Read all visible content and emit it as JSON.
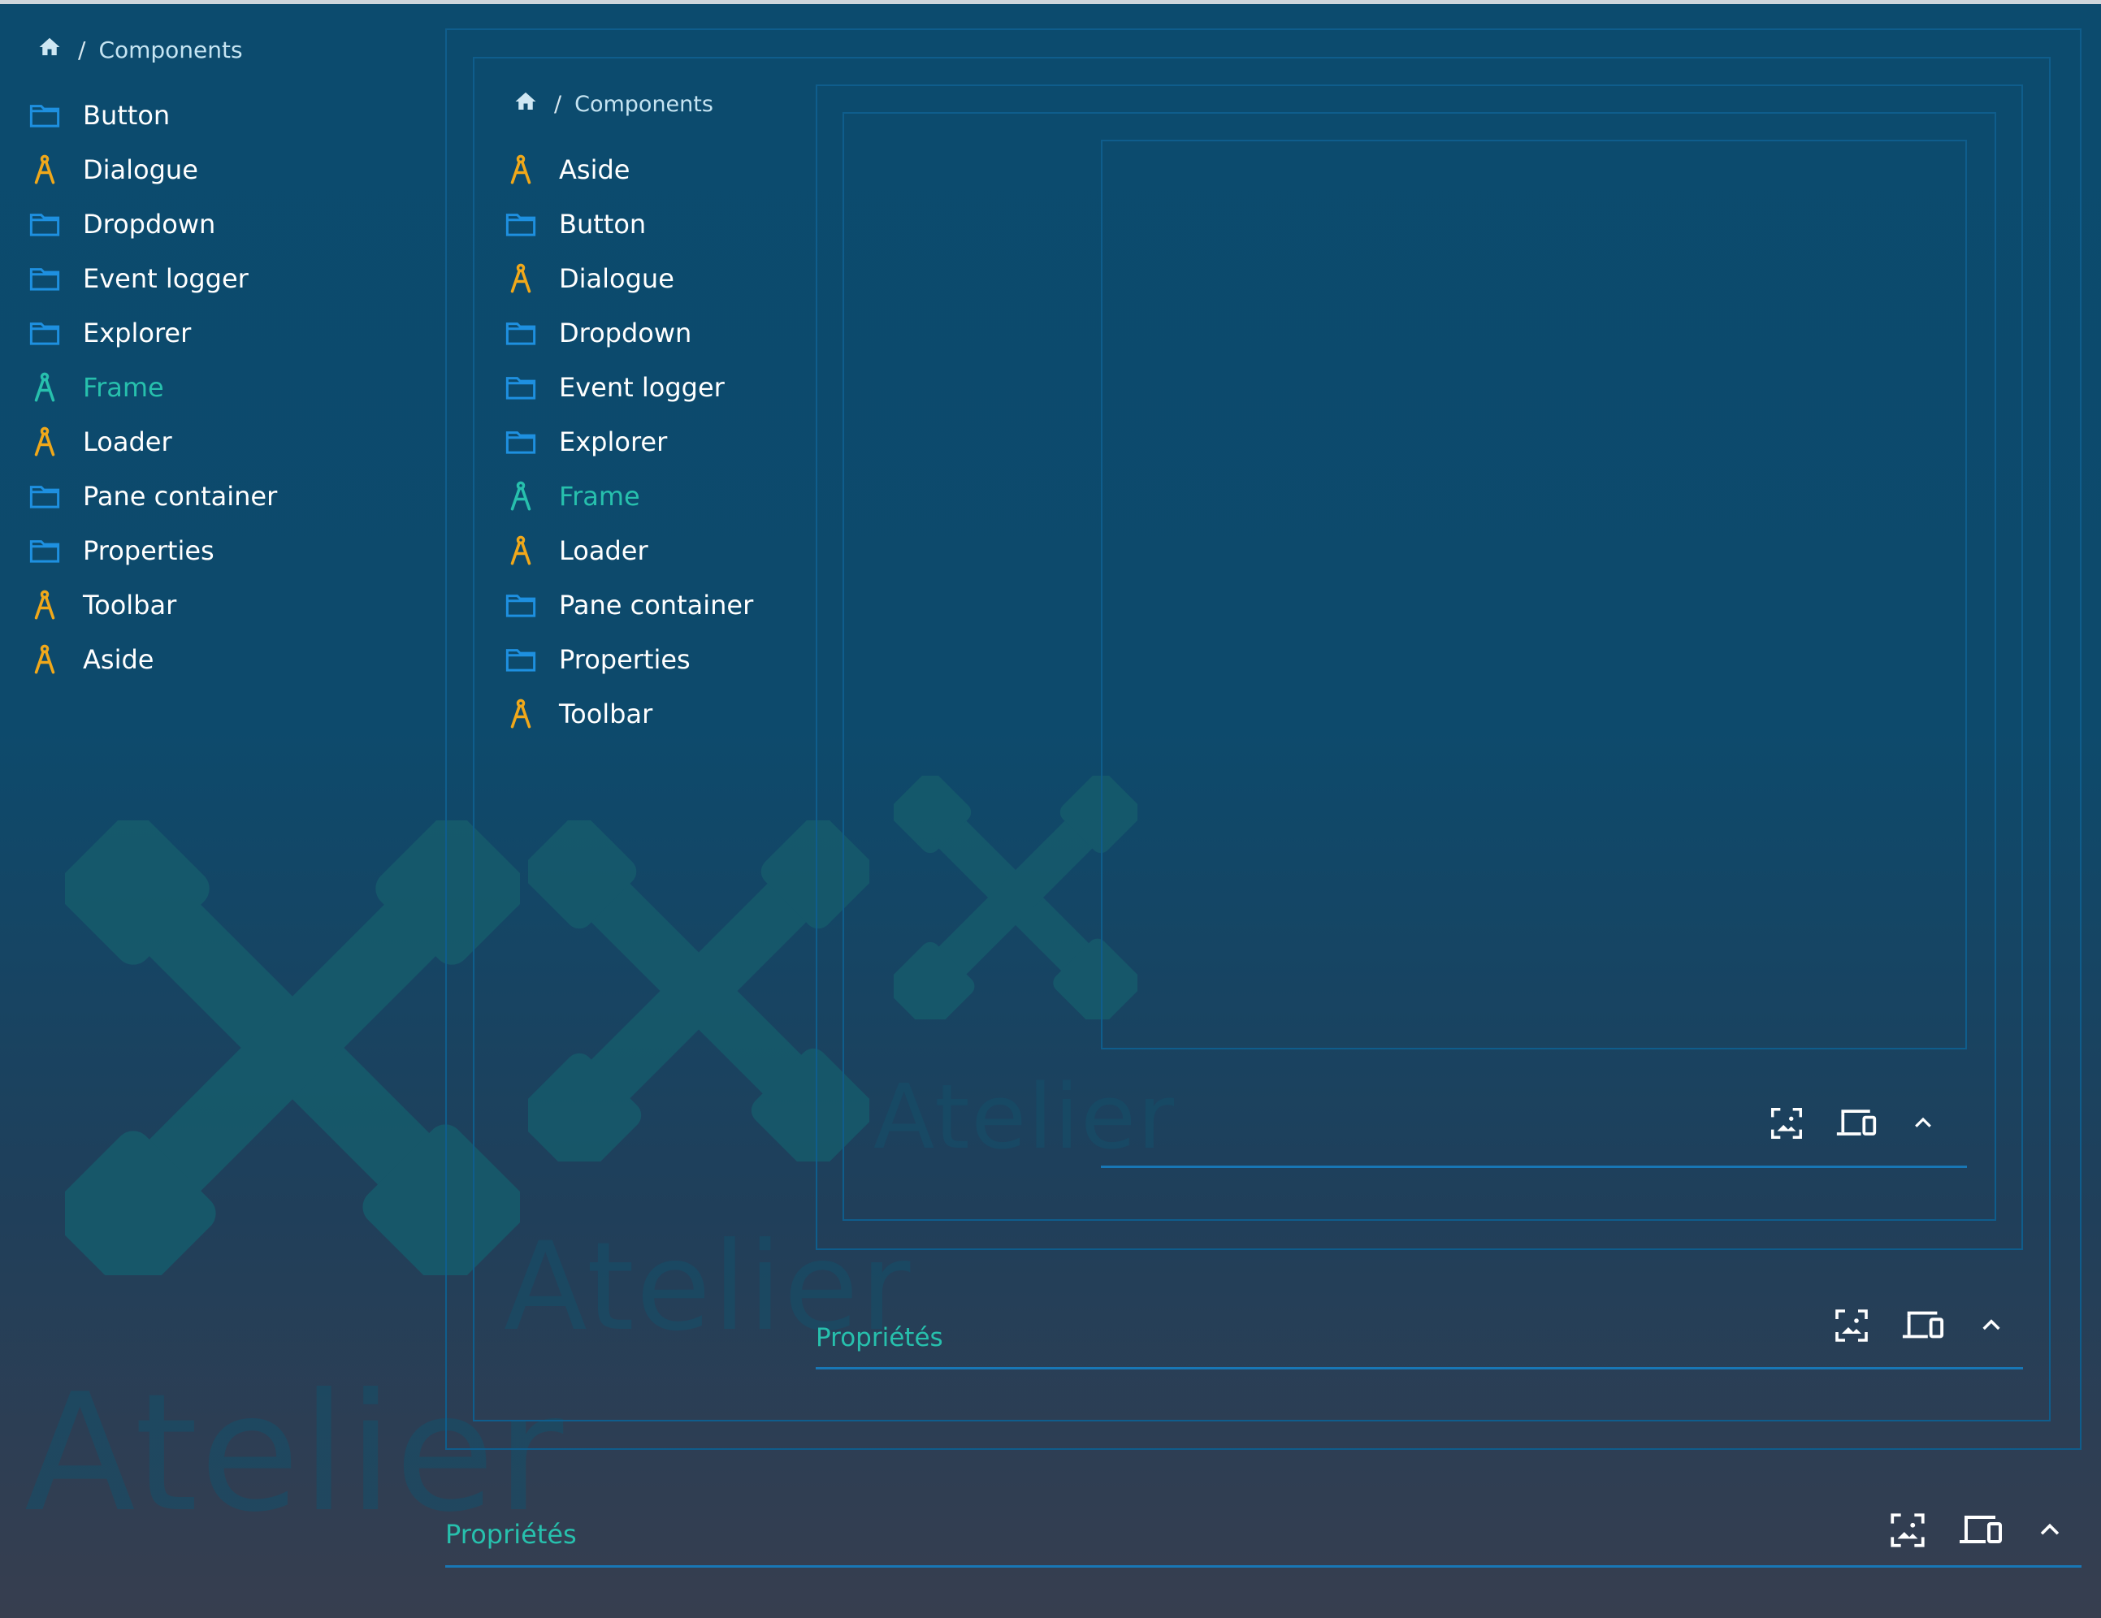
{
  "colors": {
    "accent": "#27c0ad",
    "folder": "#1e90e0",
    "compass": "#f0a81a",
    "border": "#0f5d8c",
    "underline": "#1877b5"
  },
  "watermark": {
    "text": "Atelier"
  },
  "breadcrumb": {
    "home_icon": "home-icon",
    "separator": "/",
    "label": "Components"
  },
  "level1": {
    "nav": [
      {
        "label": "Button",
        "icon": "folder-icon"
      },
      {
        "label": "Dialogue",
        "icon": "compass-icon"
      },
      {
        "label": "Dropdown",
        "icon": "folder-icon"
      },
      {
        "label": "Event logger",
        "icon": "folder-icon"
      },
      {
        "label": "Explorer",
        "icon": "folder-icon"
      },
      {
        "label": "Frame",
        "icon": "compass-icon",
        "active": true
      },
      {
        "label": "Loader",
        "icon": "compass-icon"
      },
      {
        "label": "Pane container",
        "icon": "folder-icon"
      },
      {
        "label": "Properties",
        "icon": "folder-icon"
      },
      {
        "label": "Toolbar",
        "icon": "compass-icon"
      },
      {
        "label": "Aside",
        "icon": "compass-icon"
      }
    ],
    "properties_label": "Propriétés"
  },
  "level2": {
    "nav": [
      {
        "label": "Aside",
        "icon": "compass-icon"
      },
      {
        "label": "Button",
        "icon": "folder-icon"
      },
      {
        "label": "Dialogue",
        "icon": "compass-icon"
      },
      {
        "label": "Dropdown",
        "icon": "folder-icon"
      },
      {
        "label": "Event logger",
        "icon": "folder-icon"
      },
      {
        "label": "Explorer",
        "icon": "folder-icon"
      },
      {
        "label": "Frame",
        "icon": "compass-icon",
        "active": true
      },
      {
        "label": "Loader",
        "icon": "compass-icon"
      },
      {
        "label": "Pane container",
        "icon": "folder-icon"
      },
      {
        "label": "Properties",
        "icon": "folder-icon"
      },
      {
        "label": "Toolbar",
        "icon": "compass-icon"
      }
    ],
    "properties_label": "Propriétés"
  },
  "level3": {
    "properties_label": ""
  },
  "toolbar": {
    "icons": [
      "screenshot-icon",
      "devices-icon",
      "chevron-up-icon"
    ]
  }
}
